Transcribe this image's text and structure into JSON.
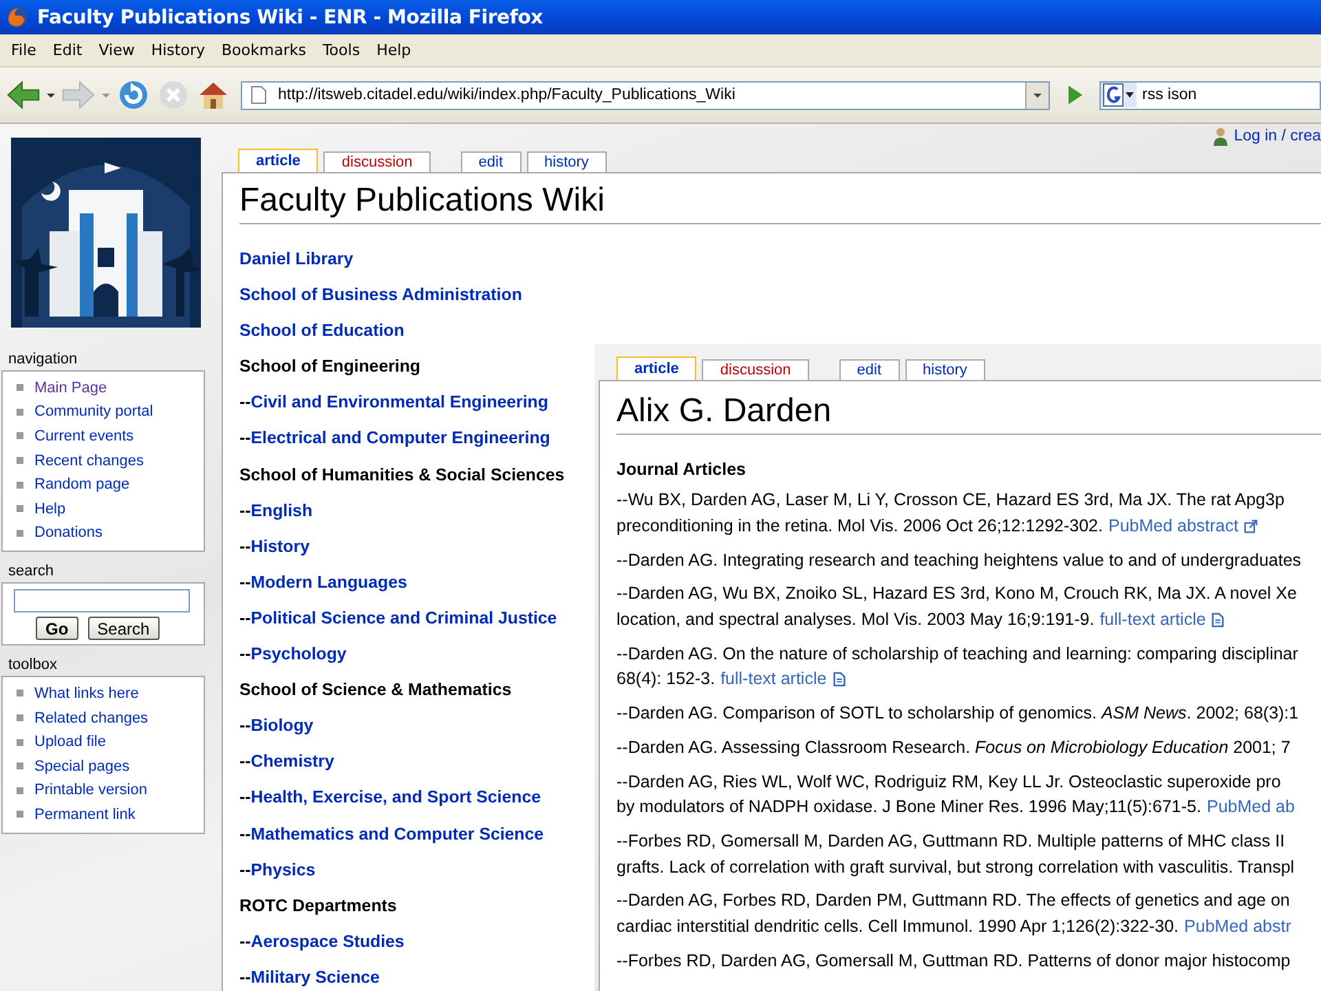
{
  "window": {
    "title": "Faculty Publications Wiki - ENR - Mozilla Firefox"
  },
  "menu": [
    "File",
    "Edit",
    "View",
    "History",
    "Bookmarks",
    "Tools",
    "Help"
  ],
  "toolbar": {
    "url": "http://itsweb.citadel.edu/wiki/index.php/Faculty_Publications_Wiki",
    "search_value": "rss ison"
  },
  "user_link": "Log in / crea",
  "sidebar": {
    "navigation": {
      "title": "navigation",
      "items": [
        {
          "label": "Main Page",
          "visited": true
        },
        {
          "label": "Community portal",
          "visited": false
        },
        {
          "label": "Current events",
          "visited": false
        },
        {
          "label": "Recent changes",
          "visited": false
        },
        {
          "label": "Random page",
          "visited": false
        },
        {
          "label": "Help",
          "visited": false
        },
        {
          "label": "Donations",
          "visited": false
        }
      ]
    },
    "search": {
      "title": "search",
      "buttons": [
        "Go",
        "Search"
      ]
    },
    "toolbox": {
      "title": "toolbox",
      "items": [
        "What links here",
        "Related changes",
        "Upload file",
        "Special pages",
        "Printable version",
        "Permanent link"
      ]
    }
  },
  "page": {
    "tabs": [
      {
        "label": "article",
        "selected": true,
        "missing": false
      },
      {
        "label": "discussion",
        "selected": false,
        "missing": true
      },
      {
        "label": "edit",
        "selected": false,
        "missing": false
      },
      {
        "label": "history",
        "selected": false,
        "missing": false
      }
    ],
    "title": "Faculty Publications Wiki",
    "items": [
      {
        "kind": "link",
        "label": "Daniel Library"
      },
      {
        "kind": "link",
        "label": "School of Business Administration"
      },
      {
        "kind": "link",
        "label": "School of Education"
      },
      {
        "kind": "heading",
        "label": "School of Engineering"
      },
      {
        "kind": "sublink",
        "prefix": "--",
        "label": "Civil and Environmental Engineering"
      },
      {
        "kind": "sublink",
        "prefix": "--",
        "label": "Electrical and Computer Engineering"
      },
      {
        "kind": "heading",
        "label": "School of Humanities & Social Sciences"
      },
      {
        "kind": "sublink",
        "prefix": "--",
        "label": "English"
      },
      {
        "kind": "sublink",
        "prefix": "--",
        "label": "History"
      },
      {
        "kind": "sublink",
        "prefix": "--",
        "label": "Modern Languages"
      },
      {
        "kind": "sublink",
        "prefix": "--",
        "label": "Political Science and Criminal Justice"
      },
      {
        "kind": "sublink",
        "prefix": "--",
        "label": "Psychology"
      },
      {
        "kind": "heading",
        "label": "School of Science & Mathematics"
      },
      {
        "kind": "sublink",
        "prefix": "--",
        "label": "Biology"
      },
      {
        "kind": "sublink",
        "prefix": "--",
        "label": "Chemistry"
      },
      {
        "kind": "sublink",
        "prefix": "--",
        "label": "Health, Exercise, and Sport Science"
      },
      {
        "kind": "sublink",
        "prefix": "--",
        "label": "Mathematics and Computer Science"
      },
      {
        "kind": "sublink",
        "prefix": "--",
        "label": "Physics"
      },
      {
        "kind": "heading",
        "label": "ROTC Departments"
      },
      {
        "kind": "sublink",
        "prefix": "--",
        "label": "Aerospace Studies"
      },
      {
        "kind": "sublink",
        "prefix": "--",
        "label": "Military Science"
      }
    ]
  },
  "overlay": {
    "tabs": [
      {
        "label": "article",
        "selected": true,
        "missing": false
      },
      {
        "label": "discussion",
        "selected": false,
        "missing": true
      },
      {
        "label": "edit",
        "selected": false,
        "missing": false
      },
      {
        "label": "history",
        "selected": false,
        "missing": false
      }
    ],
    "title": "Alix G. Darden",
    "section": "Journal Articles",
    "articles": [
      {
        "lines": [
          {
            "text": "--Wu BX, Darden AG, Laser M, Li Y, Crosson CE, Hazard ES 3rd, Ma JX. The rat Apg3p"
          },
          {
            "text": "preconditioning in the retina. Mol Vis. 2006 Oct 26;12:1292-302.",
            "link": "PubMed abstract",
            "kind": "external"
          }
        ]
      },
      {
        "lines": [
          {
            "text": "--Darden AG. Integrating research and teaching heightens value to and of undergraduates"
          }
        ]
      },
      {
        "lines": [
          {
            "text": "--Darden AG, Wu BX, Znoiko SL, Hazard ES 3rd, Kono M, Crouch RK, Ma JX. A novel Xe"
          },
          {
            "text": "location, and spectral analyses. Mol Vis. 2003 May 16;9:191-9.",
            "link": "full-text article",
            "kind": "document"
          }
        ]
      },
      {
        "lines": [
          {
            "text": "--Darden AG. On the nature of scholarship of teaching and learning: comparing disciplinar"
          },
          {
            "text": "68(4): 152-3.",
            "link": "full-text article",
            "kind": "document"
          }
        ]
      },
      {
        "lines": [
          {
            "text": "--Darden AG. Comparison of SOTL to scholarship of genomics. *ASM News*. 2002; 68(3):1"
          }
        ]
      },
      {
        "lines": [
          {
            "text": "--Darden AG. Assessing Classroom Research. *Focus on Microbiology Education* 2001; 7"
          }
        ]
      },
      {
        "lines": [
          {
            "text": "--Darden AG, Ries WL, Wolf WC, Rodriguiz RM, Key LL Jr. Osteoclastic superoxide pro"
          },
          {
            "text": "by modulators of NADPH oxidase. J Bone Miner Res. 1996 May;11(5):671-5.",
            "link": "PubMed ab"
          }
        ]
      },
      {
        "lines": [
          {
            "text": "--Forbes RD, Gomersall M, Darden AG, Guttmann RD. Multiple patterns of MHC class II"
          },
          {
            "text": "grafts. Lack of correlation with graft survival, but strong correlation with vasculitis. Transpl"
          }
        ]
      },
      {
        "lines": [
          {
            "text": "--Darden AG, Forbes RD, Darden PM, Guttmann RD. The effects of genetics and age on"
          },
          {
            "text": "cardiac interstitial dendritic cells. Cell Immunol. 1990 Apr 1;126(2):322-30.",
            "link": "PubMed abstr"
          }
        ]
      },
      {
        "lines": [
          {
            "text": "--Forbes RD, Darden AG, Gomersall M, Guttman RD. Patterns of donor major histocomp"
          }
        ]
      }
    ]
  }
}
